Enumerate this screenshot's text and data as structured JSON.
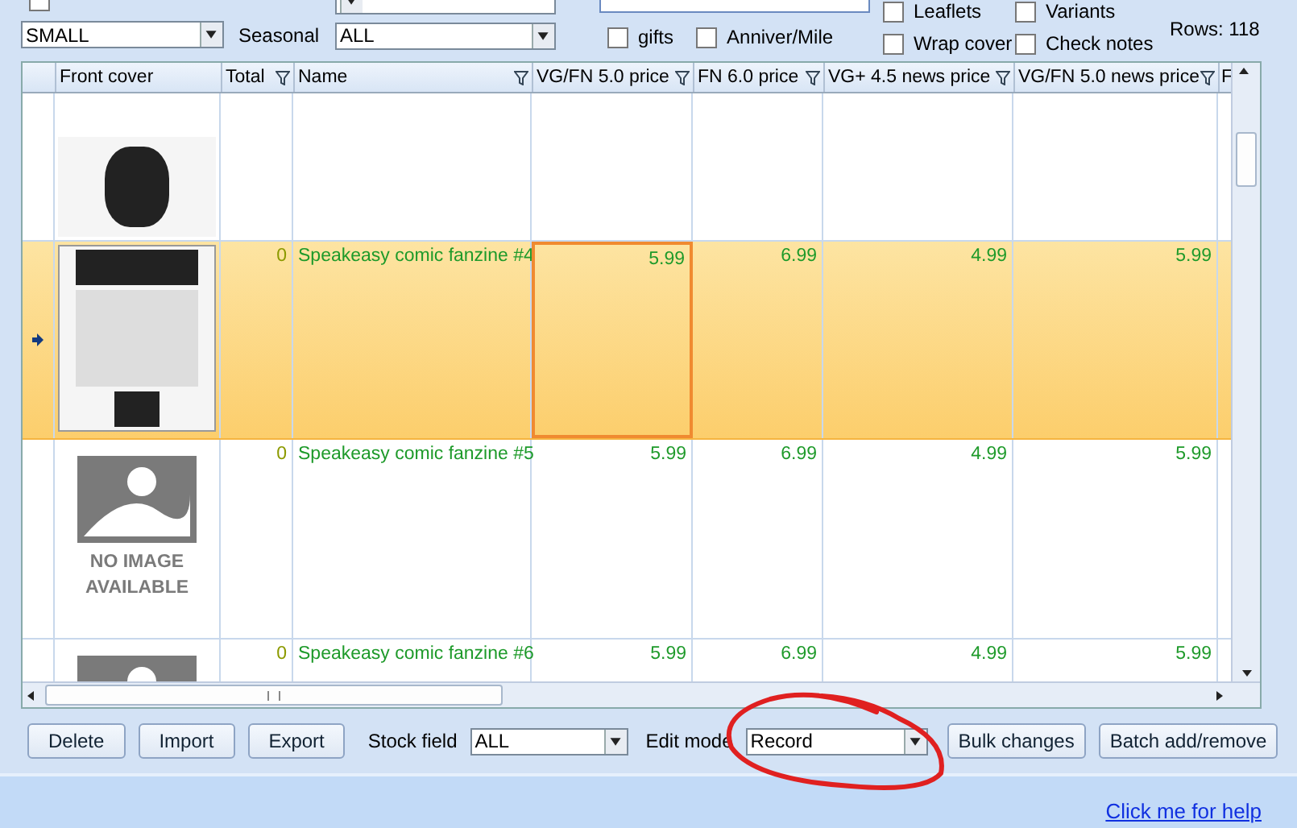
{
  "filters": {
    "show_contents": {
      "checked": false
    },
    "size": {
      "value": "SMALL"
    },
    "seasonal": {
      "label": "Seasonal",
      "value": "ALL"
    },
    "checkboxes": [
      {
        "label": "gifts",
        "checked": false
      },
      {
        "label": "Anniver/Mile",
        "checked": false
      }
    ],
    "flags": [
      {
        "label": "Leaflets",
        "checked": false
      },
      {
        "label": "Wrap cover",
        "checked": false
      },
      {
        "label": "Variants",
        "checked": false
      },
      {
        "label": "Check notes",
        "checked": false
      }
    ],
    "rows_count": "Rows: 118"
  },
  "table": {
    "columns": [
      {
        "label": "Front cover",
        "filter": false
      },
      {
        "label": "Total",
        "filter": true
      },
      {
        "label": "Name",
        "filter": true
      },
      {
        "label": "VG/FN 5.0 price",
        "filter": true
      },
      {
        "label": "FN 6.0 price",
        "filter": true
      },
      {
        "label": "VG+ 4.5 news price",
        "filter": true
      },
      {
        "label": "VG/FN 5.0 news price",
        "filter": true
      },
      {
        "label": "F",
        "filter": false
      }
    ],
    "rows": [
      {
        "selected": false,
        "cells": [
          {
            "kind": "photo"
          }
        ]
      },
      {
        "selected": true,
        "cells": [
          {
            "kind": "photo"
          },
          {
            "text": "0",
            "focused": false
          },
          {
            "text": "Speakeasy comic fanzine #4",
            "focused": false
          },
          {
            "text": "5.99",
            "focused": true
          },
          {
            "text": "6.99",
            "focused": false
          },
          {
            "text": "4.99",
            "focused": false
          },
          {
            "text": "5.99",
            "focused": false
          }
        ]
      },
      {
        "selected": false,
        "cells": [
          {
            "kind": "no_image",
            "text": "NO IMAGE AVAILABLE"
          },
          {
            "text": "0",
            "focused": false
          },
          {
            "text": "Speakeasy comic fanzine #5",
            "focused": false
          },
          {
            "text": "5.99",
            "focused": false
          },
          {
            "text": "6.99",
            "focused": false
          },
          {
            "text": "4.99",
            "focused": false
          },
          {
            "text": "5.99",
            "focused": false
          }
        ]
      },
      {
        "selected": false,
        "cells": [
          {
            "kind": "no_image"
          },
          {
            "text": "0",
            "focused": false
          },
          {
            "text": "Speakeasy comic fanzine #6",
            "focused": false
          },
          {
            "text": "5.99",
            "focused": false
          },
          {
            "text": "6.99",
            "focused": false
          },
          {
            "text": "4.99",
            "focused": false
          },
          {
            "text": "5.99",
            "focused": false
          }
        ]
      }
    ]
  },
  "toolbar": {
    "buttons": [
      "Delete",
      "Import",
      "Export"
    ],
    "stock_field": {
      "label": "Stock field",
      "value": "ALL"
    },
    "edit_mode": {
      "label": "Edit mode",
      "value": "Record"
    },
    "actions": [
      "Bulk changes",
      "Batch add/remove"
    ]
  },
  "status_bar": {
    "help_link": "Click me for help"
  }
}
